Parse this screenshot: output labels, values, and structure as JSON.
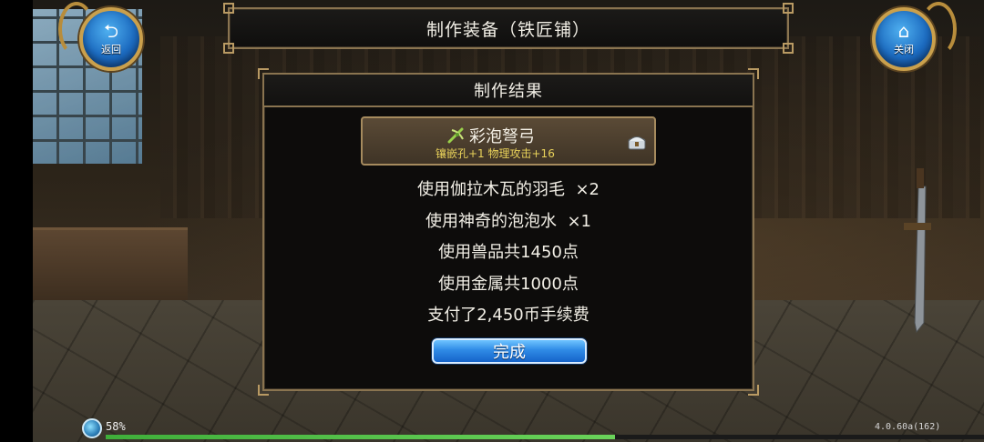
{
  "header": {
    "title": "制作装备（铁匠铺）",
    "back_label": "返回",
    "close_label": "关闭"
  },
  "panel": {
    "title": "制作结果",
    "item": {
      "name": "彩泡弩弓",
      "stats": "镶嵌孔+1 物理攻击+16",
      "icon": "crossbow-icon",
      "badge_icon": "chest-icon"
    },
    "cost_lines": [
      "使用伽拉木瓦的羽毛  ×2",
      "使用神奇的泡泡水  ×1",
      "使用兽品共1450点",
      "使用金属共1000点",
      "支付了2,450币手续费"
    ],
    "confirm_label": "完成"
  },
  "footer": {
    "loading_percent": "58%",
    "loading_fraction": 0.58,
    "version": "4.0.60a(162)"
  },
  "colors": {
    "accent_blue": "#2f8be6",
    "frame_gold": "#8a7450",
    "stat_yellow": "#e9d25a",
    "progress_green": "#3fae3a"
  }
}
